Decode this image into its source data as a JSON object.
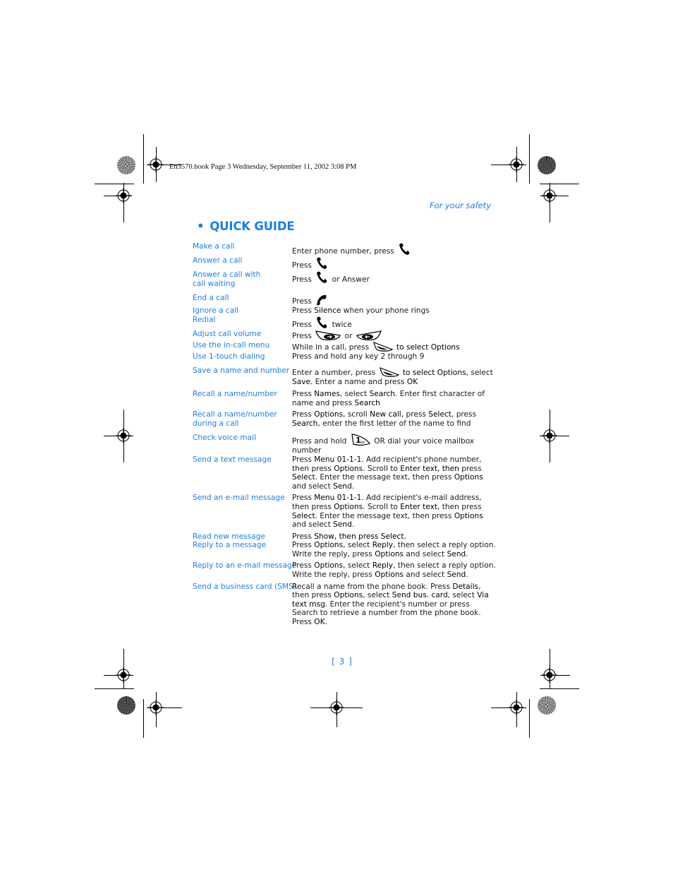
{
  "slug": "En3570.book  Page 3  Wednesday, September 11, 2002  3:08 PM",
  "running_head": "For your safety",
  "title": {
    "bullet": "•",
    "text": "QUICK GUIDE"
  },
  "colors": {
    "accent": "#1a7fe6",
    "text": "#1a1a1a"
  },
  "rows": [
    {
      "task": "Make a call",
      "desc": [
        {
          "t": "Enter phone number, press "
        },
        {
          "icon": "call-key-icon"
        }
      ]
    },
    {
      "task": "Answer a call",
      "desc": [
        {
          "t": "Press "
        },
        {
          "icon": "call-key-icon"
        }
      ]
    },
    {
      "task": "Answer a call with call waiting",
      "desc": [
        {
          "t": "Press "
        },
        {
          "icon": "call-key-icon"
        },
        {
          "t": " or Answer"
        }
      ]
    },
    {
      "task": "End a call",
      "desc": [
        {
          "t": "Press "
        },
        {
          "icon": "end-key-icon"
        }
      ]
    },
    {
      "task": "Ignore a call",
      "desc": [
        {
          "t": "Press "
        },
        {
          "b": "Silence"
        },
        {
          "t": " when your phone rings"
        }
      ]
    },
    {
      "task": "Redial",
      "desc": [
        {
          "t": "Press "
        },
        {
          "icon": "call-key-icon"
        },
        {
          "t": " twice"
        }
      ]
    },
    {
      "task": "Adjust call volume",
      "desc": [
        {
          "t": "Press "
        },
        {
          "icon": "volume-right-key-icon"
        },
        {
          "t": " or "
        },
        {
          "icon": "volume-left-key-icon"
        }
      ]
    },
    {
      "task": "Use the in-call menu",
      "desc": [
        {
          "t": "While in a call, press "
        },
        {
          "icon": "selection-key-icon"
        },
        {
          "b": "to select Options"
        }
      ]
    },
    {
      "task": "Use 1-touch dialing",
      "desc": [
        {
          "t": "Press and hold any key 2 through 9"
        }
      ]
    },
    {
      "task": "Save a name and number",
      "desc": [
        {
          "t": "Enter a number, press "
        },
        {
          "icon": "selection-key-icon"
        },
        {
          "b": " to select Options"
        },
        {
          "t": ", select "
        },
        {
          "b": "Save."
        },
        {
          "t": " Enter a name and press "
        },
        {
          "b": "OK"
        }
      ]
    },
    {
      "task": "Recall a name/number",
      "desc": [
        {
          "t": "Press "
        },
        {
          "b": "Names"
        },
        {
          "t": ", select "
        },
        {
          "b": "Search."
        },
        {
          "t": " Enter first character of name and press "
        },
        {
          "b": "Search"
        }
      ]
    },
    {
      "task": "Recall a name/number during a call",
      "desc": [
        {
          "t": "Press "
        },
        {
          "b": "Options"
        },
        {
          "t": ", scroll "
        },
        {
          "b": "New call"
        },
        {
          "t": ", press "
        },
        {
          "b": "Select"
        },
        {
          "t": ", press "
        },
        {
          "b": "Search"
        },
        {
          "t": ", enter the first letter of the name to find"
        }
      ]
    },
    {
      "task": "Check voice mail",
      "desc": [
        {
          "t": "Press and hold "
        },
        {
          "icon": "key-1-voicemail-icon"
        },
        {
          "t": " OR dial your voice mailbox number"
        }
      ]
    },
    {
      "task": "Send a text message",
      "desc": [
        {
          "t": "Press "
        },
        {
          "b": "Menu 01-1-1"
        },
        {
          "t": ". Add recipient's phone number, then press "
        },
        {
          "b": "Options"
        },
        {
          "t": ". Scroll to "
        },
        {
          "b": "Enter text, then"
        },
        {
          "t": " press "
        },
        {
          "b": "Select"
        },
        {
          "t": ". Enter the message text, then press "
        },
        {
          "b": "Options"
        },
        {
          "t": " and select "
        },
        {
          "b": "Send"
        },
        {
          "t": "."
        }
      ]
    },
    {
      "task": "Send an e-mail message",
      "desc": [
        {
          "t": "Press "
        },
        {
          "b": "Menu 01-1-1"
        },
        {
          "t": ". Add recipient's e-mail address, then press "
        },
        {
          "b": "Options"
        },
        {
          "t": ". Scroll to "
        },
        {
          "b": "Enter text,"
        },
        {
          "t": " then press "
        },
        {
          "b": "Select"
        },
        {
          "t": ". Enter the message text, then press "
        },
        {
          "b": "Options"
        },
        {
          "t": " and select "
        },
        {
          "b": "Send"
        },
        {
          "t": "."
        }
      ]
    },
    {
      "task": "Read new message",
      "desc": [
        {
          "t": "Press "
        },
        {
          "b": "Show, then press Select."
        }
      ]
    },
    {
      "task": "Reply to a message",
      "desc": [
        {
          "t": "Press "
        },
        {
          "b": "Options"
        },
        {
          "t": ", select "
        },
        {
          "b": "Reply"
        },
        {
          "t": ", then select a reply option. Write the reply, press "
        },
        {
          "b": "Options"
        },
        {
          "t": " and select "
        },
        {
          "b": "Send"
        },
        {
          "t": "."
        }
      ]
    },
    {
      "task": "Reply to an e-mail message",
      "desc": [
        {
          "t": "Press "
        },
        {
          "b": "Options"
        },
        {
          "t": ", select "
        },
        {
          "b": "Reply"
        },
        {
          "t": ", then select a reply option. Write the reply, press "
        },
        {
          "b": "Options"
        },
        {
          "t": " and select "
        },
        {
          "b": "Send"
        },
        {
          "t": "."
        }
      ]
    },
    {
      "task": "Send a business card (SMS)",
      "desc": [
        {
          "t": "Recall a name from the phone book. Press "
        },
        {
          "b": "Details"
        },
        {
          "t": ", then press "
        },
        {
          "b": "Options"
        },
        {
          "t": ", select "
        },
        {
          "b": "Send bus. card"
        },
        {
          "t": ", select "
        },
        {
          "b": "Via text msg."
        },
        {
          "t": " Enter the recipient's number or press Search to retrieve a number from the phone book. Press "
        },
        {
          "b": "OK"
        },
        {
          "t": "."
        }
      ]
    }
  ],
  "page_number": "[ 3 ]"
}
